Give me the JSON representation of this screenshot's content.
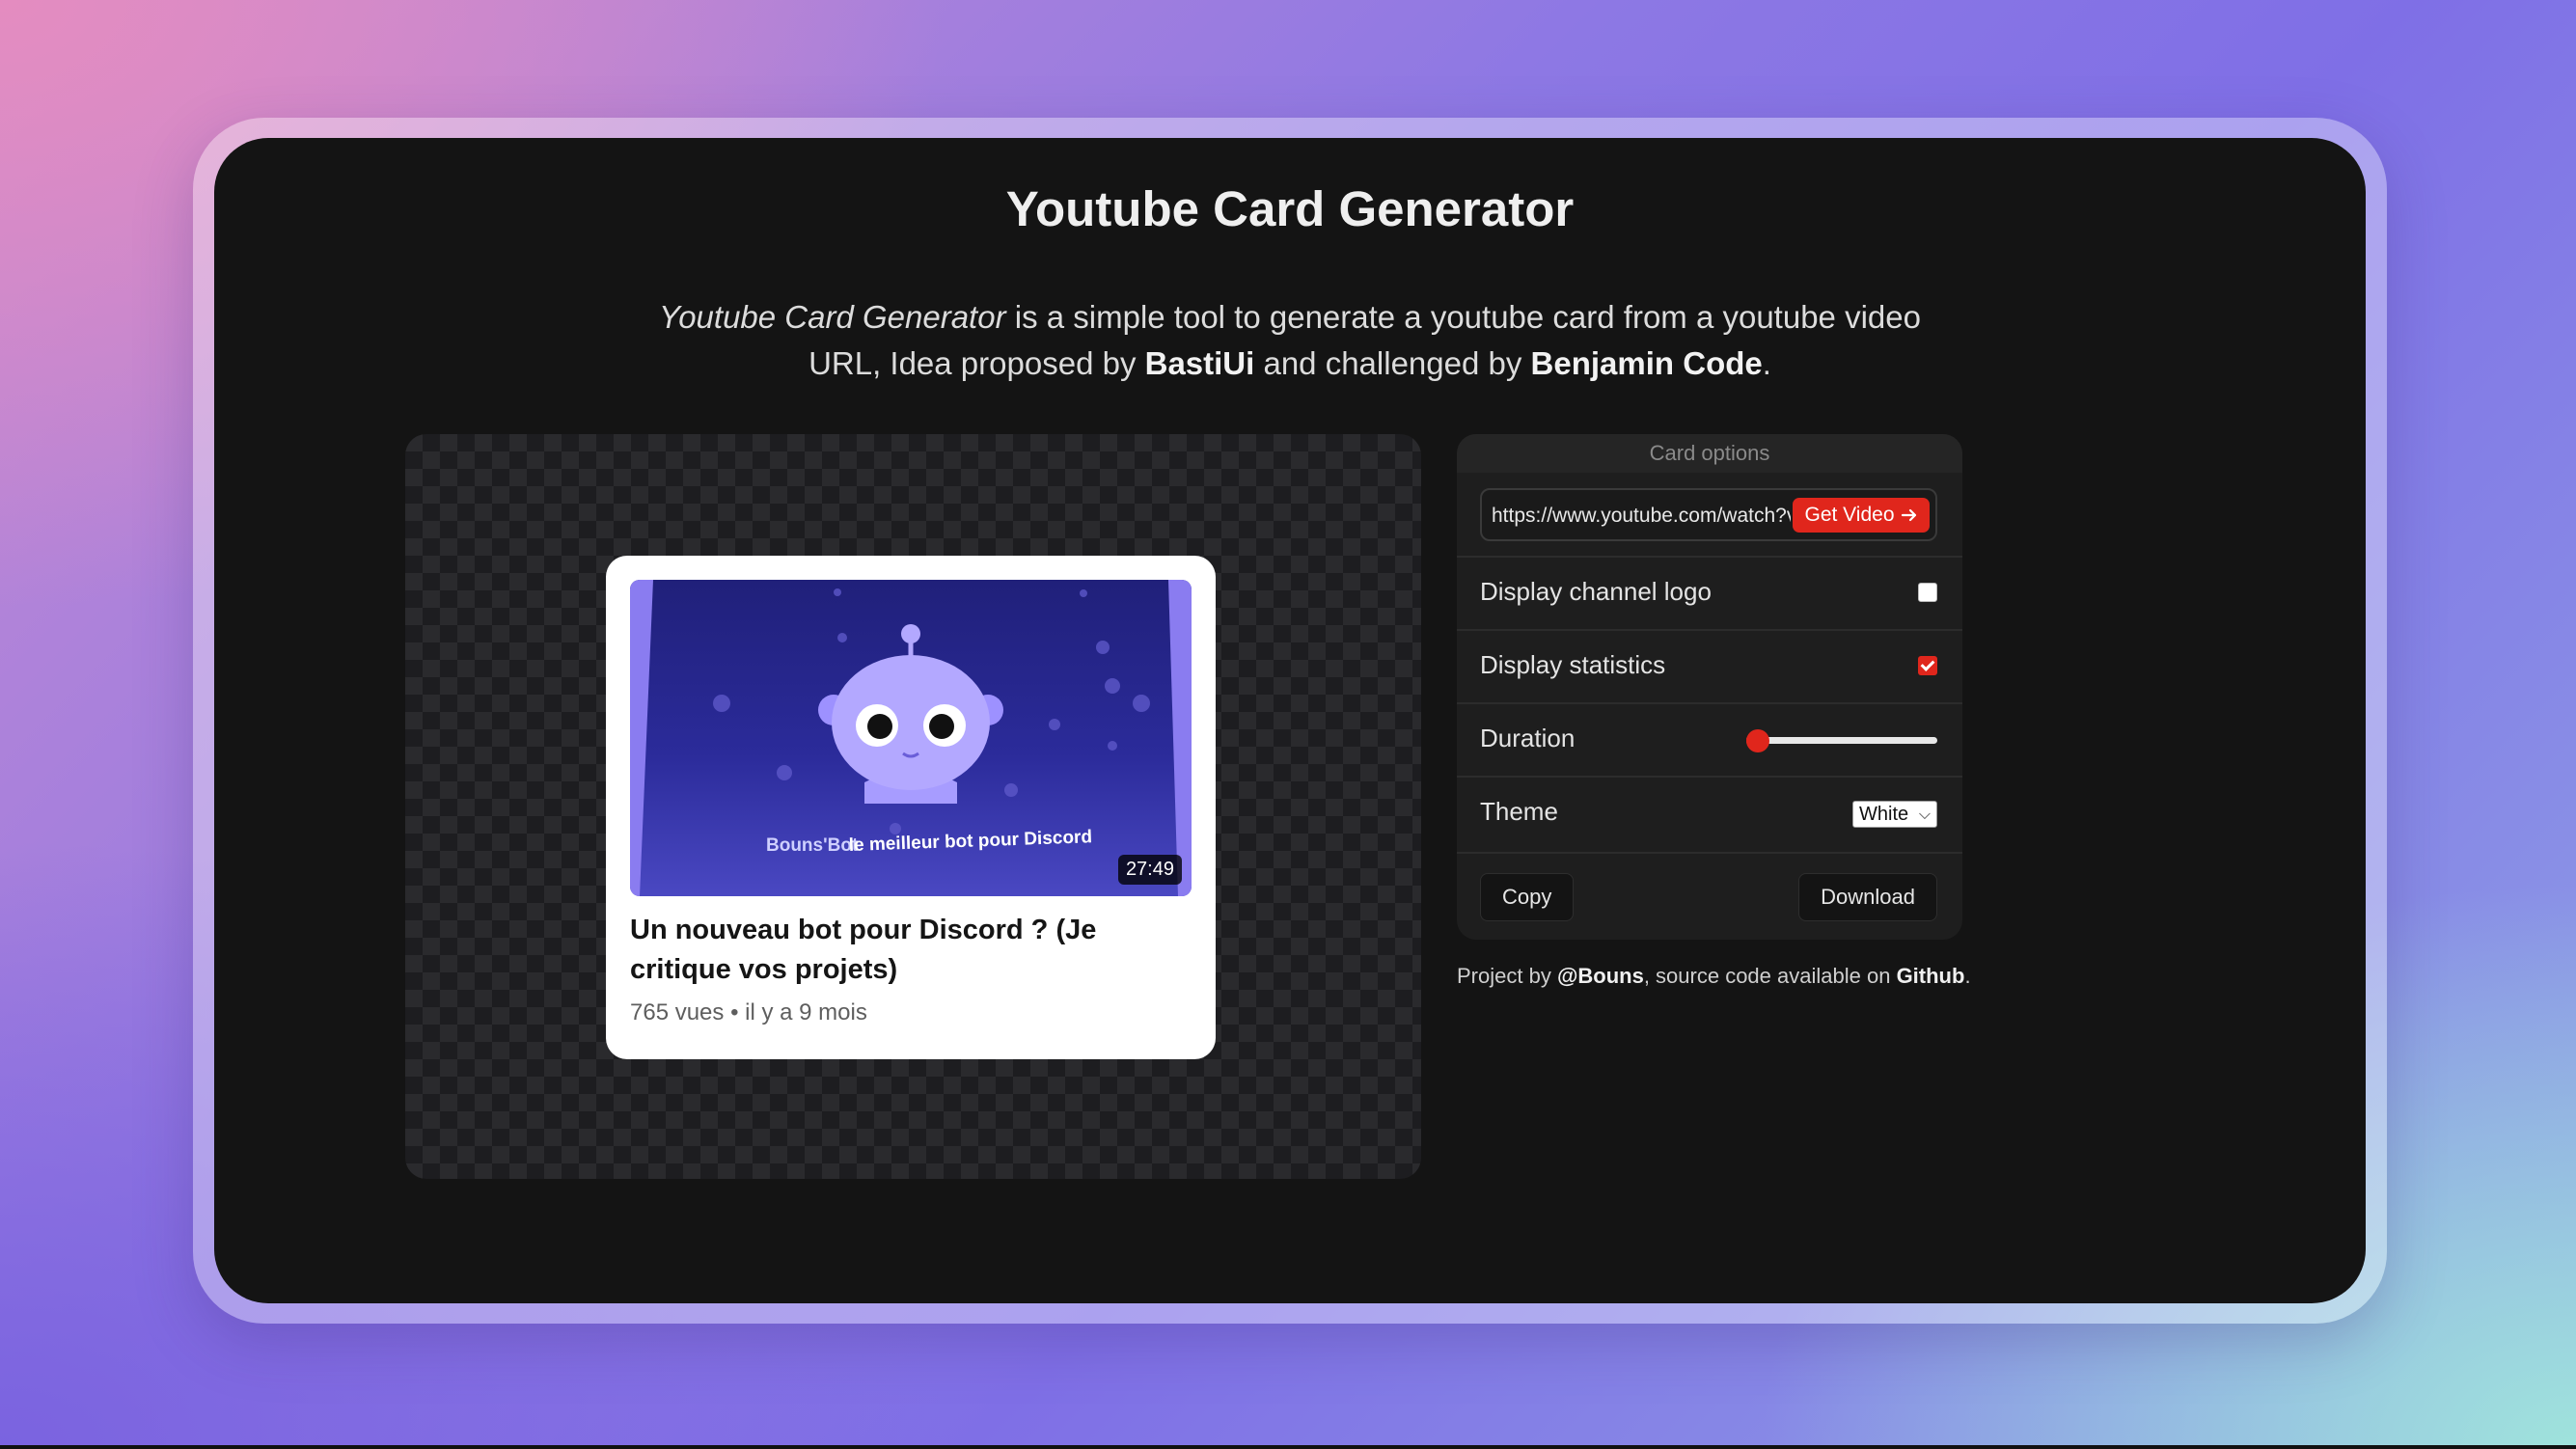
{
  "page": {
    "title": "Youtube Card Generator",
    "description": {
      "tool_name": "Youtube Card Generator",
      "text1": " is a simple tool to generate a youtube card from a youtube video URL, Idea proposed by ",
      "author1": "BastiUi",
      "text2": " and challenged by ",
      "author2": "Benjamin Code",
      "text3": "."
    }
  },
  "card": {
    "thumbnail_caption_prefix": "Bouns'Bot",
    "thumbnail_caption": "le meilleur bot pour Discord",
    "duration": "27:49",
    "title": "Un nouveau bot pour Discord ? (Je critique vos projets)",
    "stats": "765 vues • il y a 9 mois"
  },
  "options": {
    "header": "Card options",
    "url_value": "https://www.youtube.com/watch?v=",
    "get_video_label": "Get Video",
    "display_channel_logo": {
      "label": "Display channel logo",
      "checked": false
    },
    "display_statistics": {
      "label": "Display statistics",
      "checked": true
    },
    "duration": {
      "label": "Duration",
      "value_fraction": 0.02
    },
    "theme": {
      "label": "Theme",
      "selected": "White"
    },
    "copy_label": "Copy",
    "download_label": "Download"
  },
  "footer": {
    "prefix": "Project by ",
    "author": "@Bouns",
    "middle": ", source code available on ",
    "link": "Github",
    "suffix": "."
  },
  "colors": {
    "accent": "#e0261c",
    "screen_bg": "#141414",
    "panel_bg": "#1e1e1e"
  }
}
